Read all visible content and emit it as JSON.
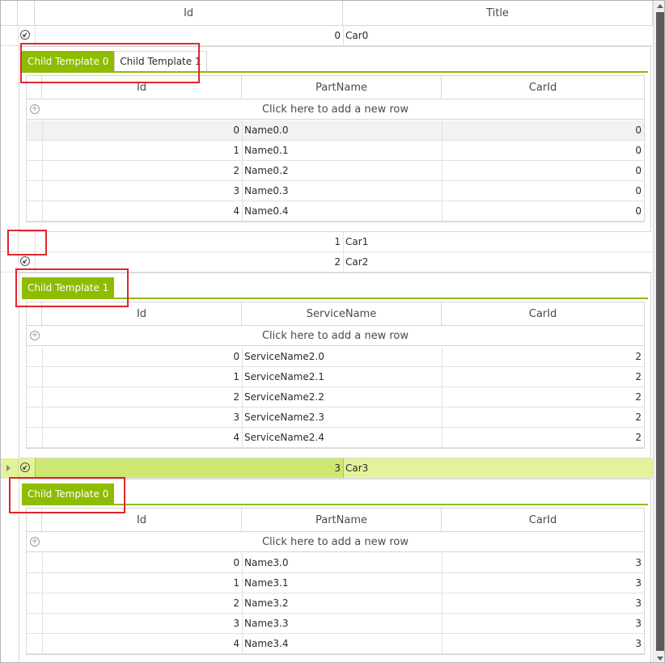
{
  "grid": {
    "columns": [
      "Id",
      "Title"
    ],
    "rows": [
      {
        "id": "0",
        "title": "Car0",
        "expanded": true
      },
      {
        "id": "1",
        "title": "Car1",
        "expanded": false
      },
      {
        "id": "2",
        "title": "Car2",
        "expanded": true
      },
      {
        "id": "3",
        "title": "Car3",
        "expanded": true,
        "selected": true
      }
    ]
  },
  "details": [
    {
      "tabs": [
        "Child Template 0",
        "Child Template 1"
      ],
      "selected_tab": 0,
      "columns": [
        "Id",
        "PartName",
        "CarId"
      ],
      "new_row_label": "Click here to add a new row",
      "rows": [
        [
          "0",
          "Name0.0",
          "0"
        ],
        [
          "1",
          "Name0.1",
          "0"
        ],
        [
          "2",
          "Name0.2",
          "0"
        ],
        [
          "3",
          "Name0.3",
          "0"
        ],
        [
          "4",
          "Name0.4",
          "0"
        ]
      ]
    },
    {
      "tabs": [
        "Child Template 1"
      ],
      "selected_tab": 0,
      "columns": [
        "Id",
        "ServiceName",
        "CarId"
      ],
      "new_row_label": "Click here to add a new row",
      "rows": [
        [
          "0",
          "ServiceName2.0",
          "2"
        ],
        [
          "1",
          "ServiceName2.1",
          "2"
        ],
        [
          "2",
          "ServiceName2.2",
          "2"
        ],
        [
          "3",
          "ServiceName2.3",
          "2"
        ],
        [
          "4",
          "ServiceName2.4",
          "2"
        ]
      ]
    },
    {
      "tabs": [
        "Child Template 0"
      ],
      "selected_tab": 0,
      "columns": [
        "Id",
        "PartName",
        "CarId"
      ],
      "new_row_label": "Click here to add a new row",
      "rows": [
        [
          "0",
          "Name3.0",
          "3"
        ],
        [
          "1",
          "Name3.1",
          "3"
        ],
        [
          "2",
          "Name3.2",
          "3"
        ],
        [
          "3",
          "Name3.3",
          "3"
        ],
        [
          "4",
          "Name3.4",
          "3"
        ]
      ]
    }
  ],
  "colors": {
    "accent": "#8ebc00",
    "selected_row": "#e3f39a",
    "selected_cell": "#cde871",
    "annotation": "#e0262e"
  }
}
